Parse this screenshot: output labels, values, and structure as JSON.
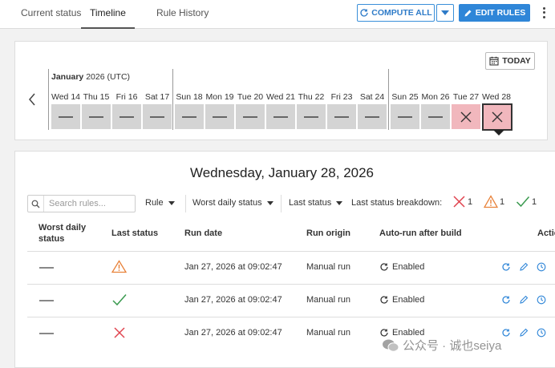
{
  "tabs": [
    {
      "label": "Current status",
      "active": false
    },
    {
      "label": "Timeline",
      "active": true
    },
    {
      "label": "Rule History",
      "active": false
    }
  ],
  "toolbar": {
    "compute_label": "COMPUTE ALL",
    "edit_label": "EDIT RULES"
  },
  "timeline": {
    "today_label": "TODAY",
    "month": "January",
    "year_tz": "2026 (UTC)",
    "days": [
      {
        "label": "Wed 14",
        "status": "none"
      },
      {
        "label": "Thu 15",
        "status": "none"
      },
      {
        "label": "Fri 16",
        "status": "none"
      },
      {
        "label": "Sat 17",
        "status": "none"
      },
      {
        "label": "Sun 18",
        "status": "none"
      },
      {
        "label": "Mon 19",
        "status": "none"
      },
      {
        "label": "Tue 20",
        "status": "none"
      },
      {
        "label": "Wed 21",
        "status": "none"
      },
      {
        "label": "Thu 22",
        "status": "none"
      },
      {
        "label": "Fri 23",
        "status": "none"
      },
      {
        "label": "Sat 24",
        "status": "none"
      },
      {
        "label": "Sun 25",
        "status": "none"
      },
      {
        "label": "Mon 26",
        "status": "none"
      },
      {
        "label": "Tue 27",
        "status": "error"
      },
      {
        "label": "Wed 28",
        "status": "error",
        "selected": true
      }
    ]
  },
  "details": {
    "title": "Wednesday, January 28, 2026",
    "search_placeholder": "Search rules...",
    "filters": {
      "rule": "Rule",
      "worst": "Worst daily status",
      "last": "Last status"
    },
    "breakdown_label": "Last status breakdown:",
    "breakdown": {
      "error": "1",
      "warning": "1",
      "ok": "1"
    },
    "columns": {
      "worst_line1": "Worst daily",
      "worst_line2": "status",
      "last_status": "Last status",
      "run_date": "Run date",
      "run_origin": "Run origin",
      "auto_run": "Auto-run after build",
      "actions": "Actio"
    },
    "rows": [
      {
        "last_status": "warning",
        "run_date": "Jan 27, 2026 at 09:02:47",
        "run_origin": "Manual run",
        "auto_run": "Enabled"
      },
      {
        "last_status": "ok",
        "run_date": "Jan 27, 2026 at 09:02:47",
        "run_origin": "Manual run",
        "auto_run": "Enabled"
      },
      {
        "last_status": "error",
        "run_date": "Jan 27, 2026 at 09:02:47",
        "run_origin": "Manual run",
        "auto_run": "Enabled"
      }
    ]
  },
  "watermark": "公众号 · 诚也seiya",
  "colors": {
    "accent": "#2f86d8",
    "error": "#e0444f",
    "warning": "#e8823a",
    "ok": "#3a9a4f",
    "error_bg": "#f1b7bd"
  }
}
